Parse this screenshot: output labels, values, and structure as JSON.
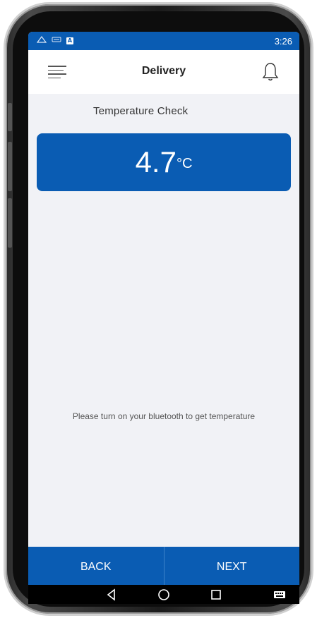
{
  "status_bar": {
    "time": "3:26",
    "icons": [
      "signal-icon",
      "keyboard-icon",
      "a-badge-icon"
    ],
    "badge_letter": "A"
  },
  "header": {
    "title": "Delivery",
    "menu_icon": "hamburger-menu-icon",
    "bell_icon": "notification-bell-icon"
  },
  "temperature": {
    "section_title": "Temperature Check",
    "value": "4.7",
    "unit": "°C"
  },
  "message": "Please turn on your bluetooth to get temperature",
  "footer": {
    "back_label": "BACK",
    "next_label": "NEXT"
  },
  "nav": {
    "icons": [
      "back-triangle-icon",
      "home-circle-icon",
      "recents-square-icon",
      "keyboard-icon"
    ]
  },
  "colors": {
    "primary": "#0a5cb3",
    "background": "#f1f2f6",
    "header_bg": "#ffffff"
  }
}
